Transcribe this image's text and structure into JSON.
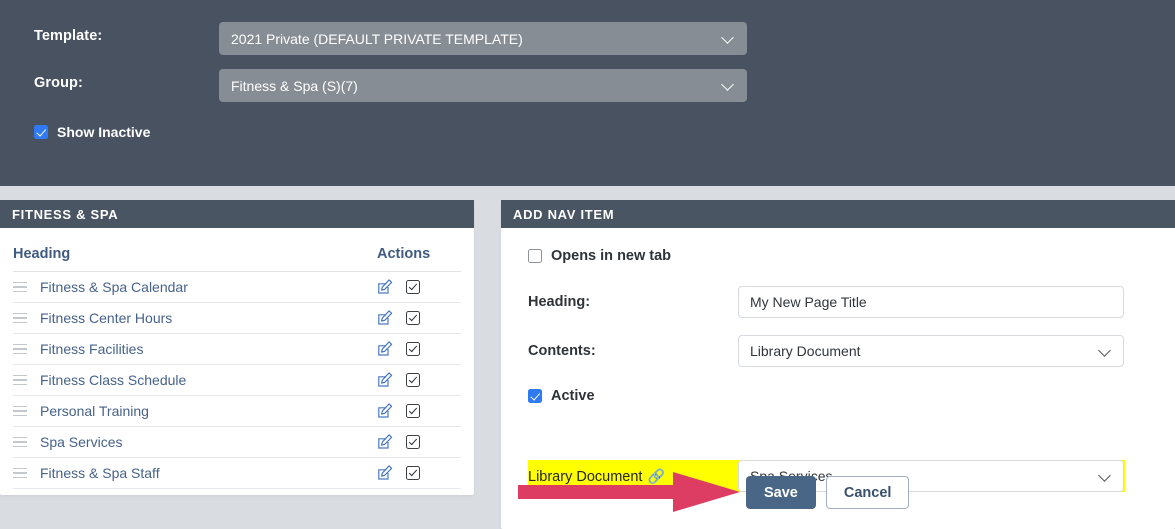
{
  "topbar": {
    "template": {
      "label": "Template:",
      "value": "2021 Private (DEFAULT PRIVATE TEMPLATE)"
    },
    "group": {
      "label": "Group:",
      "value": "Fitness & Spa (S)(7)"
    },
    "show_inactive": {
      "label": "Show Inactive",
      "checked": true
    }
  },
  "left_panel": {
    "title": "FITNESS & SPA",
    "columns": {
      "heading": "Heading",
      "actions": "Actions"
    },
    "rows": [
      {
        "heading": "Fitness & Spa Calendar",
        "edit_icon": "edit-pencil-icon",
        "active_icon": "checkbox-checked-icon"
      },
      {
        "heading": "Fitness Center Hours",
        "edit_icon": "edit-pencil-icon",
        "active_icon": "checkbox-checked-icon"
      },
      {
        "heading": "Fitness Facilities",
        "edit_icon": "edit-pencil-icon",
        "active_icon": "checkbox-checked-icon"
      },
      {
        "heading": "Fitness Class Schedule",
        "edit_icon": "edit-pencil-icon",
        "active_icon": "checkbox-checked-icon"
      },
      {
        "heading": "Personal Training",
        "edit_icon": "edit-pencil-icon",
        "active_icon": "checkbox-checked-icon"
      },
      {
        "heading": "Spa Services",
        "edit_icon": "edit-pencil-icon",
        "active_icon": "checkbox-checked-icon"
      },
      {
        "heading": "Fitness & Spa Staff",
        "edit_icon": "edit-pencil-icon",
        "active_icon": "checkbox-checked-icon"
      }
    ]
  },
  "right_panel": {
    "title": "ADD NAV ITEM",
    "opens_in_new_tab": {
      "label": "Opens in new tab",
      "checked": false
    },
    "heading_field": {
      "label": "Heading:",
      "value": "My New Page Title",
      "placeholder": "My New Page Title"
    },
    "contents_field": {
      "label": "Contents:",
      "value": "Library Document"
    },
    "active": {
      "label": "Active",
      "checked": true
    },
    "library_document": {
      "label": "Library Document",
      "link_icon": "link-chain-icon",
      "value": "Spa Services",
      "highlighted": true
    },
    "buttons": {
      "save": "Save",
      "cancel": "Cancel"
    }
  },
  "annotations": {
    "arrow": {
      "name": "red-arrow-pointing-to-save",
      "color": "#dd3c63",
      "direction": "right"
    }
  },
  "colors": {
    "topbar_bg": "#485260",
    "card_header_bg": "#4a5563",
    "page_bg": "#d9dce0",
    "dark_select_bg": "#878d95",
    "accent_blue": "#2f7bf6",
    "link_text": "#46628a",
    "save_button": "#4a6686",
    "highlight_yellow": "#ffff00",
    "arrow_red": "#dd3c63"
  }
}
